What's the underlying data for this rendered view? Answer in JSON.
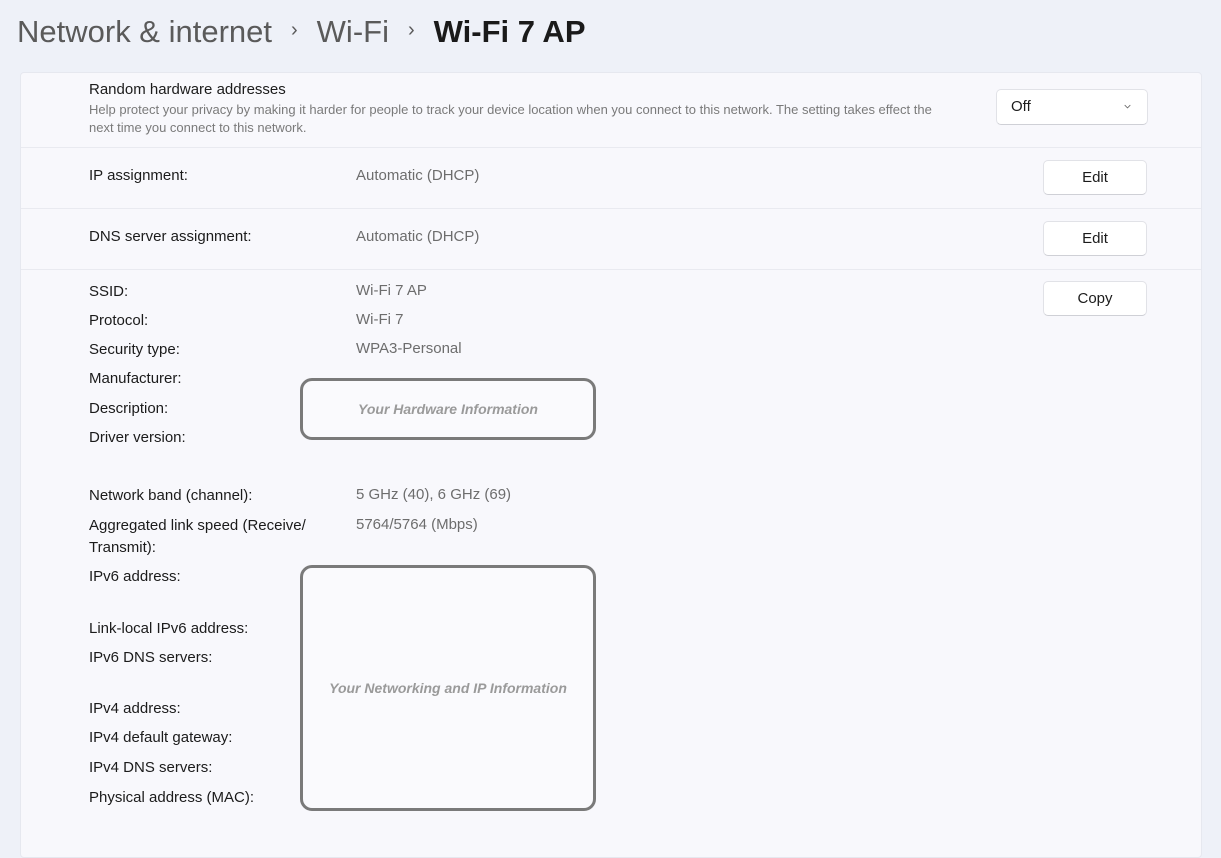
{
  "breadcrumb": {
    "items": [
      "Network & internet",
      "Wi-Fi"
    ],
    "current": "Wi-Fi 7 AP",
    "separator": "›"
  },
  "random_hw": {
    "title": "Random hardware addresses",
    "description": "Help protect your privacy by making it harder for people to track your device location when you connect to this network. The setting takes effect the next time you connect to this network.",
    "selected": "Off"
  },
  "ip_assignment": {
    "label": "IP assignment:",
    "value": "Automatic (DHCP)",
    "button": "Edit"
  },
  "dns_assignment": {
    "label": "DNS server assignment:",
    "value": "Automatic (DHCP)",
    "button": "Edit"
  },
  "properties": {
    "copy_button": "Copy",
    "ssid": {
      "label": "SSID:",
      "value": "Wi-Fi 7 AP"
    },
    "protocol": {
      "label": "Protocol:",
      "value": "Wi-Fi 7"
    },
    "security": {
      "label": "Security type:",
      "value": "WPA3-Personal"
    },
    "manufacturer": {
      "label": "Manufacturer:"
    },
    "description": {
      "label": "Description:"
    },
    "driver": {
      "label": "Driver version:"
    },
    "hardware_redaction": "Your Hardware Information",
    "band": {
      "label": "Network band (channel):",
      "value": "5 GHz (40), 6 GHz (69)"
    },
    "link_speed": {
      "label_line1": "Aggregated link speed (Receive/",
      "label_line2": "Transmit):",
      "value": "5764/5764 (Mbps)"
    },
    "ipv6": {
      "label": "IPv6 address:"
    },
    "link_local_ipv6": {
      "label": "Link-local IPv6 address:"
    },
    "ipv6_dns": {
      "label": "IPv6 DNS servers:"
    },
    "ipv4": {
      "label": "IPv4 address:"
    },
    "ipv4_gateway": {
      "label": "IPv4 default gateway:"
    },
    "ipv4_dns": {
      "label": "IPv4 DNS servers:"
    },
    "mac": {
      "label": "Physical address (MAC):"
    },
    "network_redaction": "Your Networking and IP Information"
  }
}
